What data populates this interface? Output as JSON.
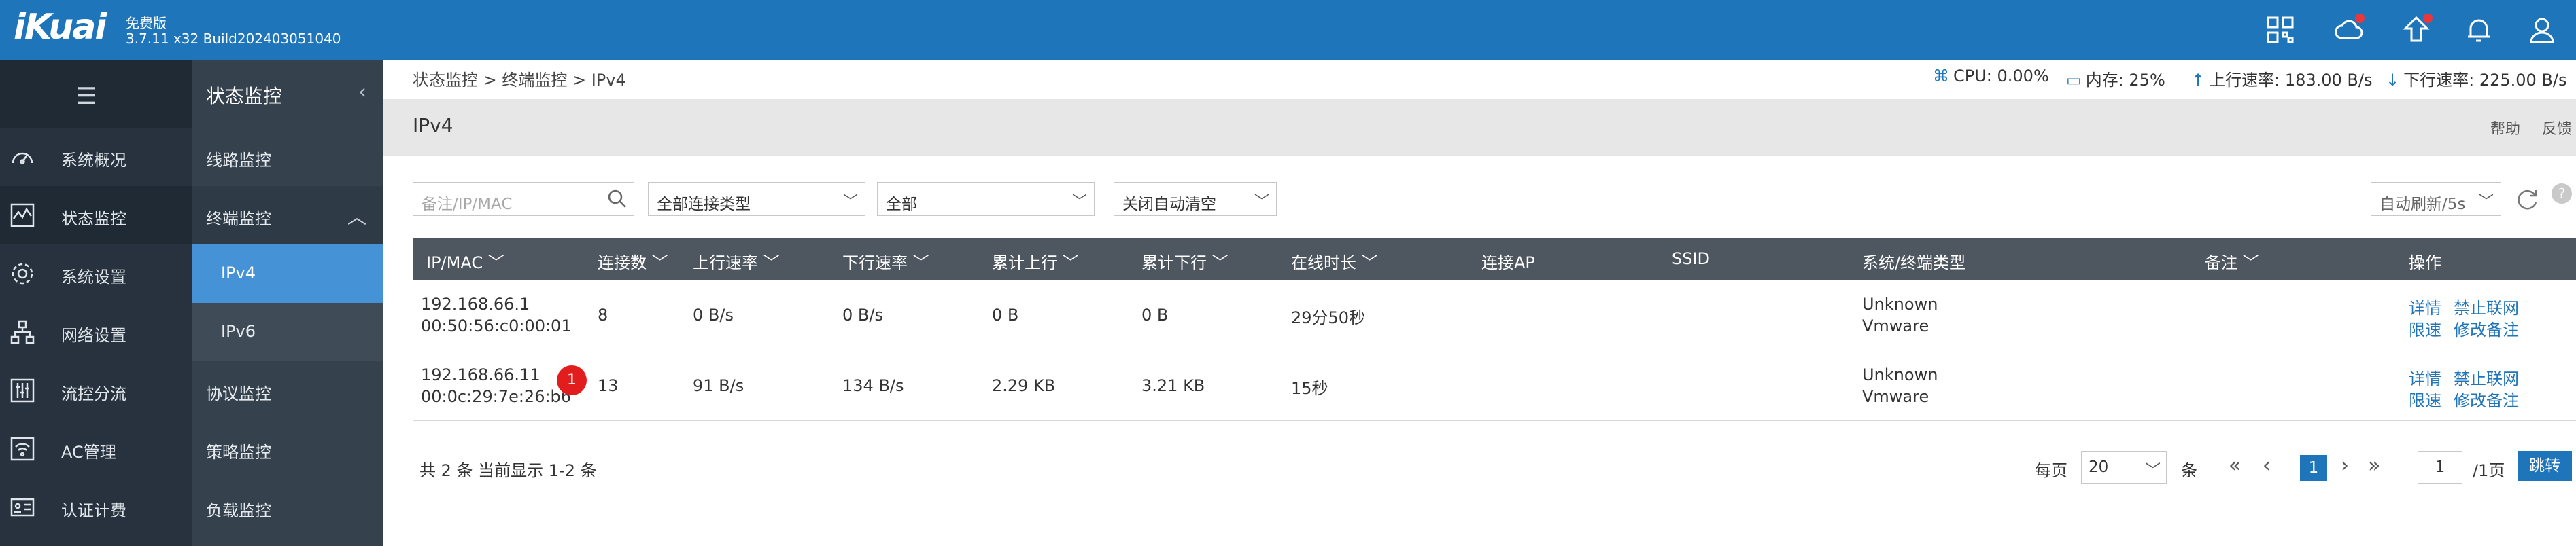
{
  "brand": {
    "logo": "iKuai",
    "edition": "免费版",
    "version": "3.7.11 x32 Build202403051040"
  },
  "sidebar_main": [
    {
      "label": "系统概况",
      "icon": "dashboard-icon"
    },
    {
      "label": "状态监控",
      "icon": "monitor-icon",
      "active": true
    },
    {
      "label": "系统设置",
      "icon": "gear-icon"
    },
    {
      "label": "网络设置",
      "icon": "network-icon"
    },
    {
      "label": "流控分流",
      "icon": "sliders-icon"
    },
    {
      "label": "AC管理",
      "icon": "wifi-icon"
    },
    {
      "label": "认证计费",
      "icon": "id-card-icon"
    }
  ],
  "sidebar_sub": {
    "title": "状态监控",
    "items": [
      {
        "label": "线路监控"
      },
      {
        "label": "终端监控",
        "open": true
      },
      {
        "label": "IPv4",
        "selected": true
      },
      {
        "label": "IPv6"
      },
      {
        "label": "协议监控"
      },
      {
        "label": "策略监控"
      },
      {
        "label": "负载监控"
      }
    ]
  },
  "breadcrumb": "状态监控 > 终端监控 > IPv4",
  "status": {
    "cpu": "CPU: 0.00%",
    "memory": "内存: 25%",
    "upload": "上行速率: 183.00 B/s",
    "download": "下行速率: 225.00 B/s"
  },
  "page": {
    "title": "IPv4",
    "help": "帮助",
    "feedback": "反馈"
  },
  "filters": {
    "search_placeholder": "备注/IP/MAC",
    "conn_type": "全部连接类型",
    "scope": "全部",
    "auto_clear": "关闭自动清空",
    "auto_refresh": "自动刷新/5s"
  },
  "table": {
    "headers": {
      "ip_mac": "IP/MAC",
      "conns": "连接数",
      "up_rate": "上行速率",
      "down_rate": "下行速率",
      "total_up": "累计上行",
      "total_down": "累计下行",
      "online": "在线时长",
      "ap": "连接AP",
      "ssid": "SSID",
      "os": "系统/终端类型",
      "remark": "备注",
      "ops": "操作"
    },
    "rows": [
      {
        "ip": "192.168.66.1",
        "mac": "00:50:56:c0:00:01",
        "conns": "8",
        "up": "0 B/s",
        "down": "0 B/s",
        "total_up": "0 B",
        "total_down": "0 B",
        "online": "29分50秒",
        "os": "Unknown",
        "device": "Vmware",
        "op1": "详情",
        "op2": "禁止联网",
        "op3": "限速",
        "op4": "修改备注"
      },
      {
        "ip": "192.168.66.11",
        "mac": "00:0c:29:7e:26:b6",
        "badge": "1",
        "conns": "13",
        "up": "91 B/s",
        "down": "134 B/s",
        "total_up": "2.29 KB",
        "total_down": "3.21 KB",
        "online": "15秒",
        "os": "Unknown",
        "device": "Vmware",
        "op1": "详情",
        "op2": "禁止联网",
        "op3": "限速",
        "op4": "修改备注"
      }
    ]
  },
  "footer": {
    "summary": "共 2 条 当前显示 1-2 条",
    "per_page_label": "每页",
    "per_page": "20",
    "per_page_unit": "条",
    "current_page": "1",
    "page_input": "1",
    "total_pages": "/1页",
    "go": "跳转"
  }
}
